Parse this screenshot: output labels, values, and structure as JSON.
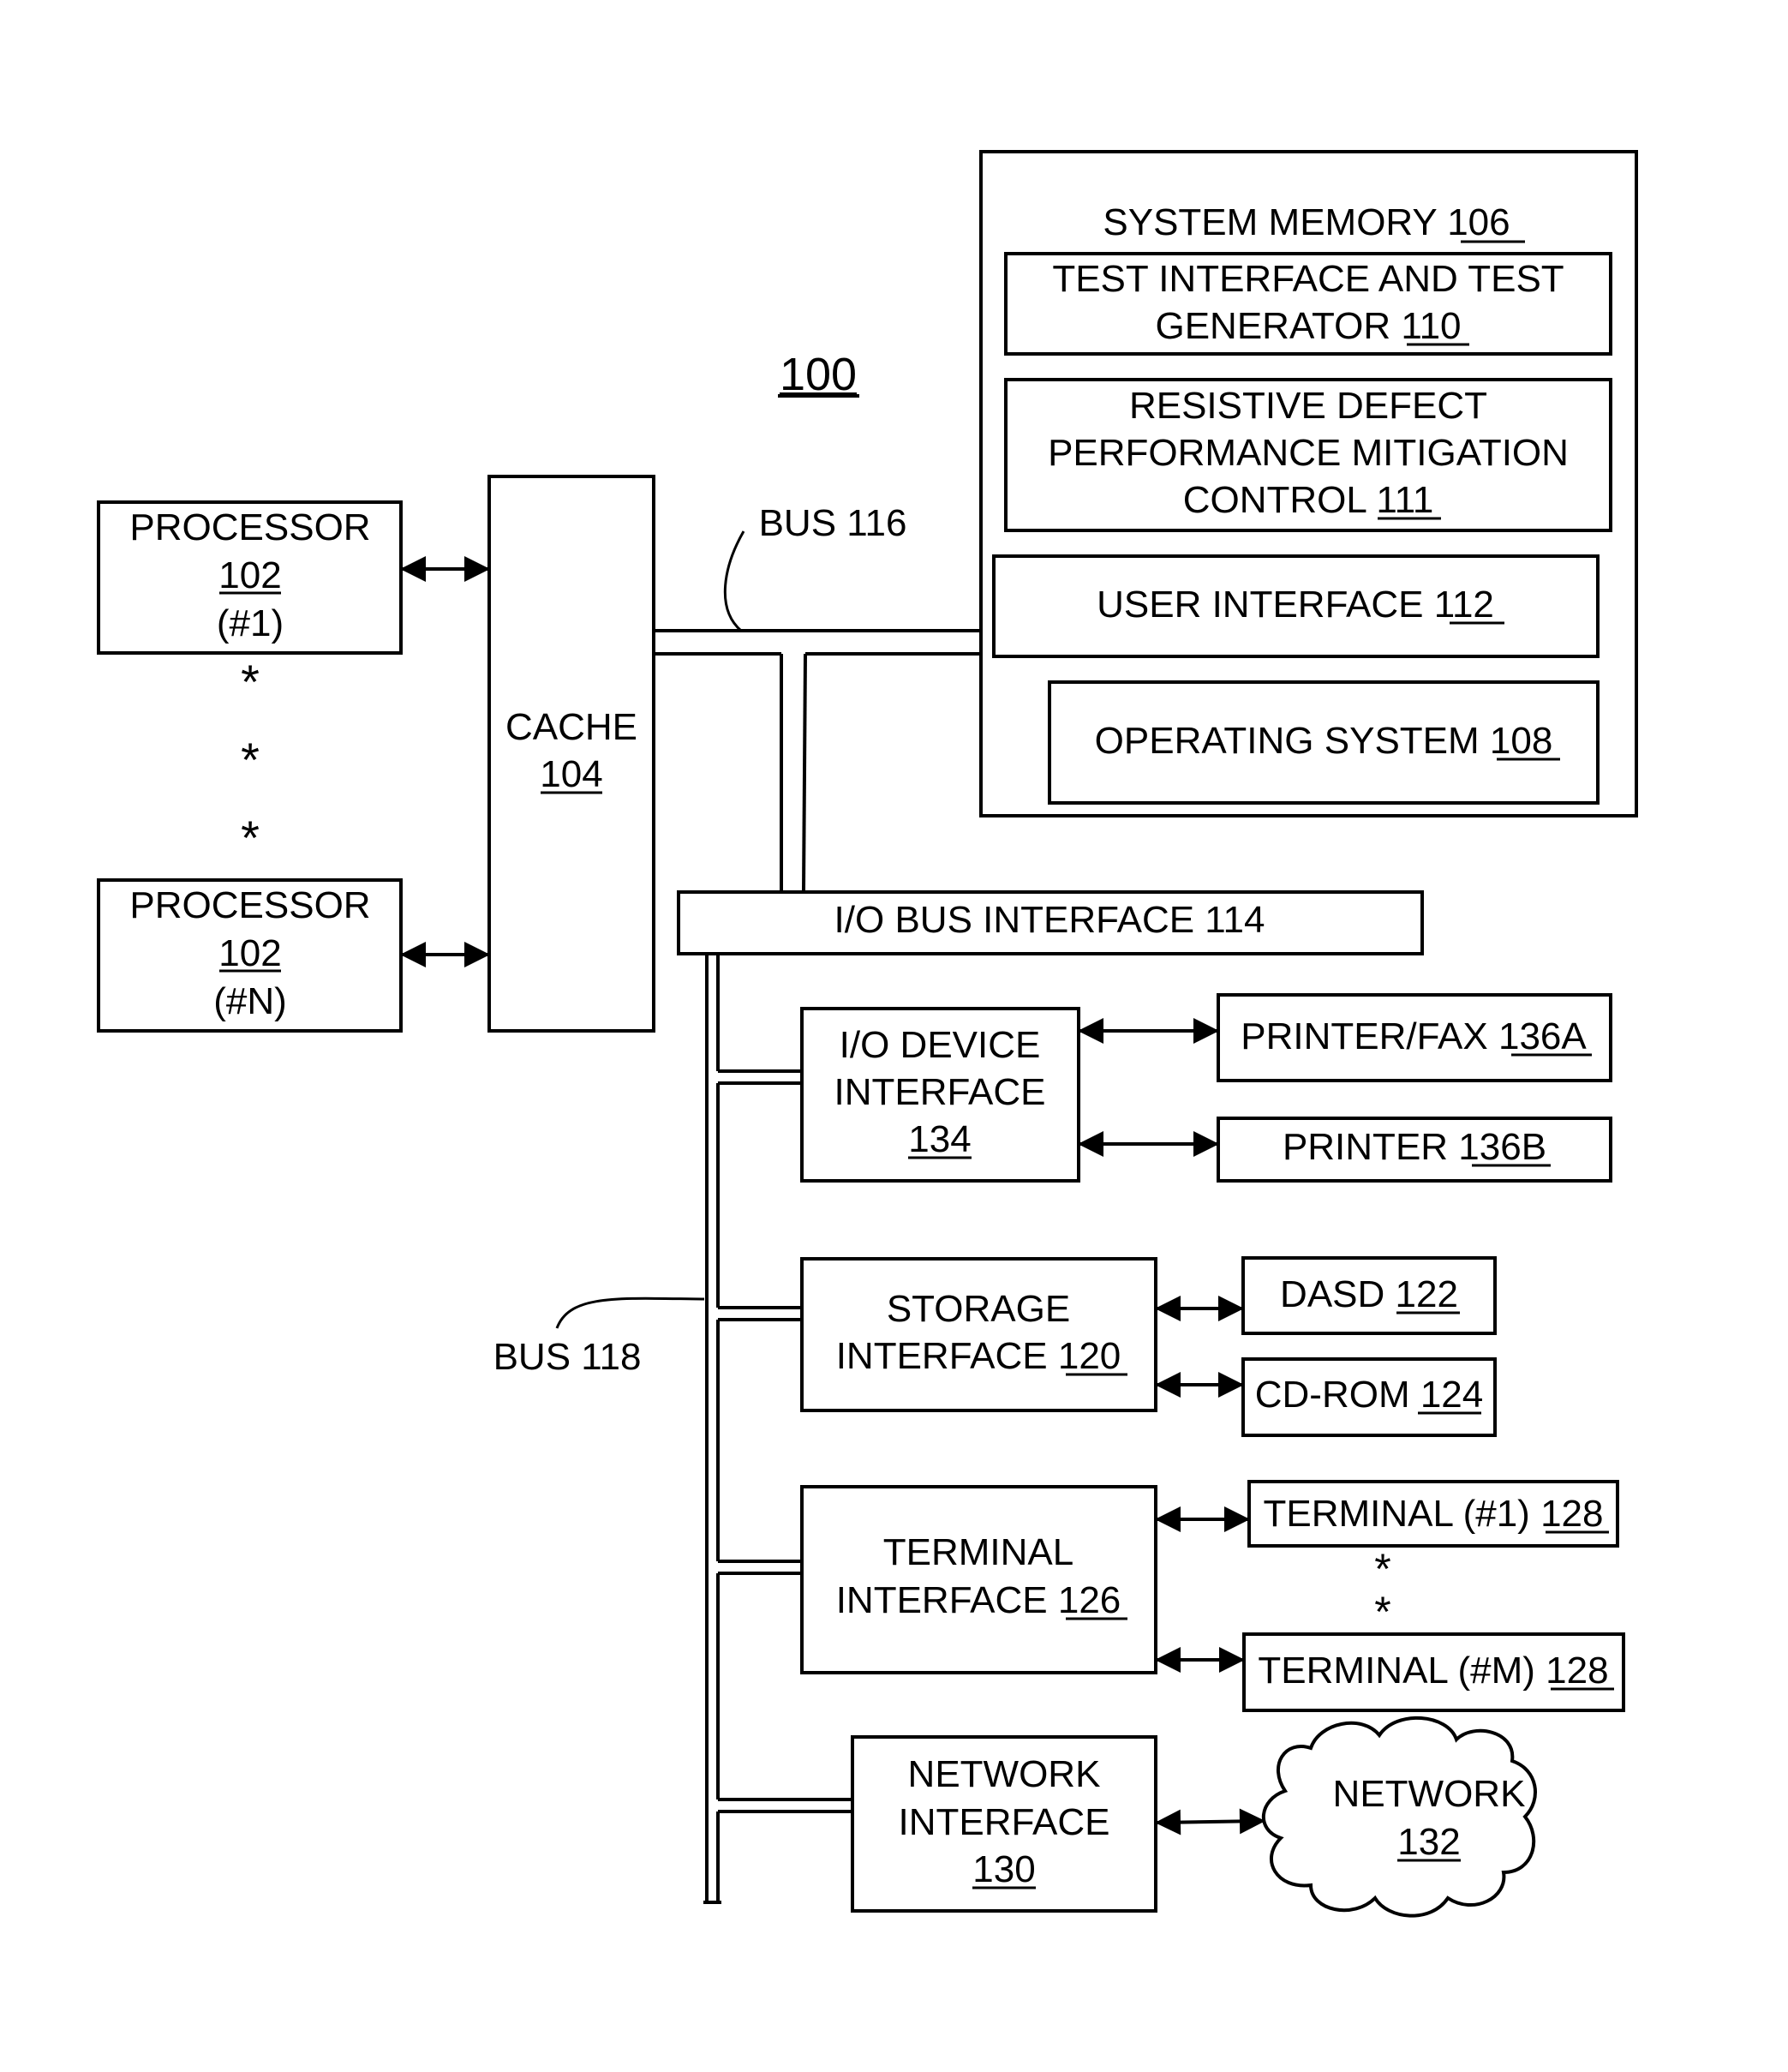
{
  "figure_label": "100",
  "colors": {
    "stroke": "#000000",
    "background": "#ffffff"
  },
  "processors": [
    {
      "title": "PROCESSOR",
      "ref": "102",
      "instance": "(#1)"
    },
    {
      "title": "PROCESSOR",
      "ref": "102",
      "instance": "(#N)"
    }
  ],
  "ellipsis": "*",
  "cache": {
    "title": "CACHE",
    "ref": "104"
  },
  "bus116": {
    "label": "BUS 116"
  },
  "bus118": {
    "label": "BUS 118"
  },
  "system_memory": {
    "title": "SYSTEM MEMORY",
    "ref": "106",
    "test_interface": {
      "line1": "TEST INTERFACE  AND TEST",
      "line2": "GENERATOR",
      "ref": "110"
    },
    "resistive": {
      "line1": "RESISTIVE DEFECT",
      "line2": "PERFORMANCE MITIGATION",
      "line3": "CONTROL",
      "ref": "111"
    },
    "user_interface": {
      "title": "USER INTERFACE",
      "ref": "112"
    },
    "operating_system": {
      "title": "OPERATING SYSTEM",
      "ref": "108"
    }
  },
  "io_bus_interface": {
    "label": "I/O BUS INTERFACE 114"
  },
  "io_device_interface": {
    "line1": "I/O DEVICE",
    "line2": "INTERFACE",
    "ref": "134"
  },
  "printer_fax": {
    "title": "PRINTER/FAX",
    "ref": "136A"
  },
  "printer": {
    "title": "PRINTER",
    "ref": "136B"
  },
  "storage_interface": {
    "line1": "STORAGE",
    "line2": "INTERFACE",
    "ref": "120"
  },
  "dasd": {
    "title": "DASD",
    "ref": "122"
  },
  "cdrom": {
    "title": "CD-ROM",
    "ref": "124"
  },
  "terminal_interface": {
    "line1": "TERMINAL",
    "line2": "INTERFACE",
    "ref": "126"
  },
  "terminal1": {
    "title": "TERMINAL (#1)",
    "ref": "128"
  },
  "terminalM": {
    "title": "TERMINAL (#M)",
    "ref": "128"
  },
  "network_interface": {
    "line1": "NETWORK",
    "line2": "INTERFACE",
    "ref": "130"
  },
  "network": {
    "title": "NETWORK",
    "ref": "132"
  }
}
